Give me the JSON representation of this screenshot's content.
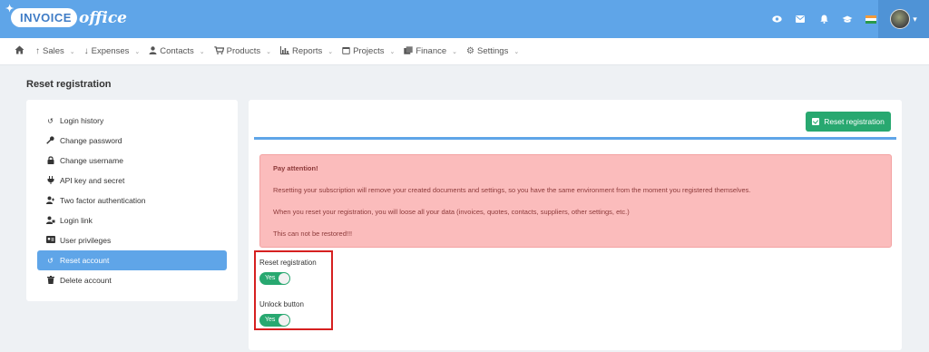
{
  "header": {
    "logo_main": "INVOICE",
    "logo_accent": "office",
    "icons": [
      "eye-icon",
      "mail-icon",
      "bell-icon",
      "graduation-cap-icon",
      "india-flag-icon"
    ]
  },
  "nav": {
    "items": [
      {
        "icon": "↑",
        "label": "Sales"
      },
      {
        "icon": "↓",
        "label": "Expenses"
      },
      {
        "icon": "👤",
        "label": "Contacts"
      },
      {
        "icon": "🛒",
        "label": "Products"
      },
      {
        "icon": "📊",
        "label": "Reports"
      },
      {
        "icon": "▦",
        "label": "Projects"
      },
      {
        "icon": "▤",
        "label": "Finance"
      },
      {
        "icon": "⚙",
        "label": "Settings"
      }
    ]
  },
  "page": {
    "title": "Reset registration"
  },
  "sidebar": {
    "items": [
      {
        "label": "Login history"
      },
      {
        "label": "Change password"
      },
      {
        "label": "Change username"
      },
      {
        "label": "API key and secret"
      },
      {
        "label": "Two factor authentication"
      },
      {
        "label": "Login link"
      },
      {
        "label": "User privileges"
      },
      {
        "label": "Reset account"
      },
      {
        "label": "Delete account"
      }
    ]
  },
  "main": {
    "button_label": "Reset registration",
    "alert": {
      "title": "Pay attention!",
      "line1": "Resetting your subscription will remove your created documents and settings, so you have the same environment from the moment you registered themselves.",
      "line2": "When you reset your registration, you will loose all your data (invoices, quotes, contacts, suppliers, other settings, etc.)",
      "line3": "This can not be restored!!!"
    },
    "toggles": [
      {
        "label": "Reset registration",
        "value": "Yes"
      },
      {
        "label": "Unlock button",
        "value": "Yes"
      }
    ]
  },
  "colors": {
    "header": "#5fa5e8",
    "active": "#5fa5e8",
    "button": "#28a870",
    "alert_bg": "#fbbcbc",
    "highlight": "#d62020"
  }
}
